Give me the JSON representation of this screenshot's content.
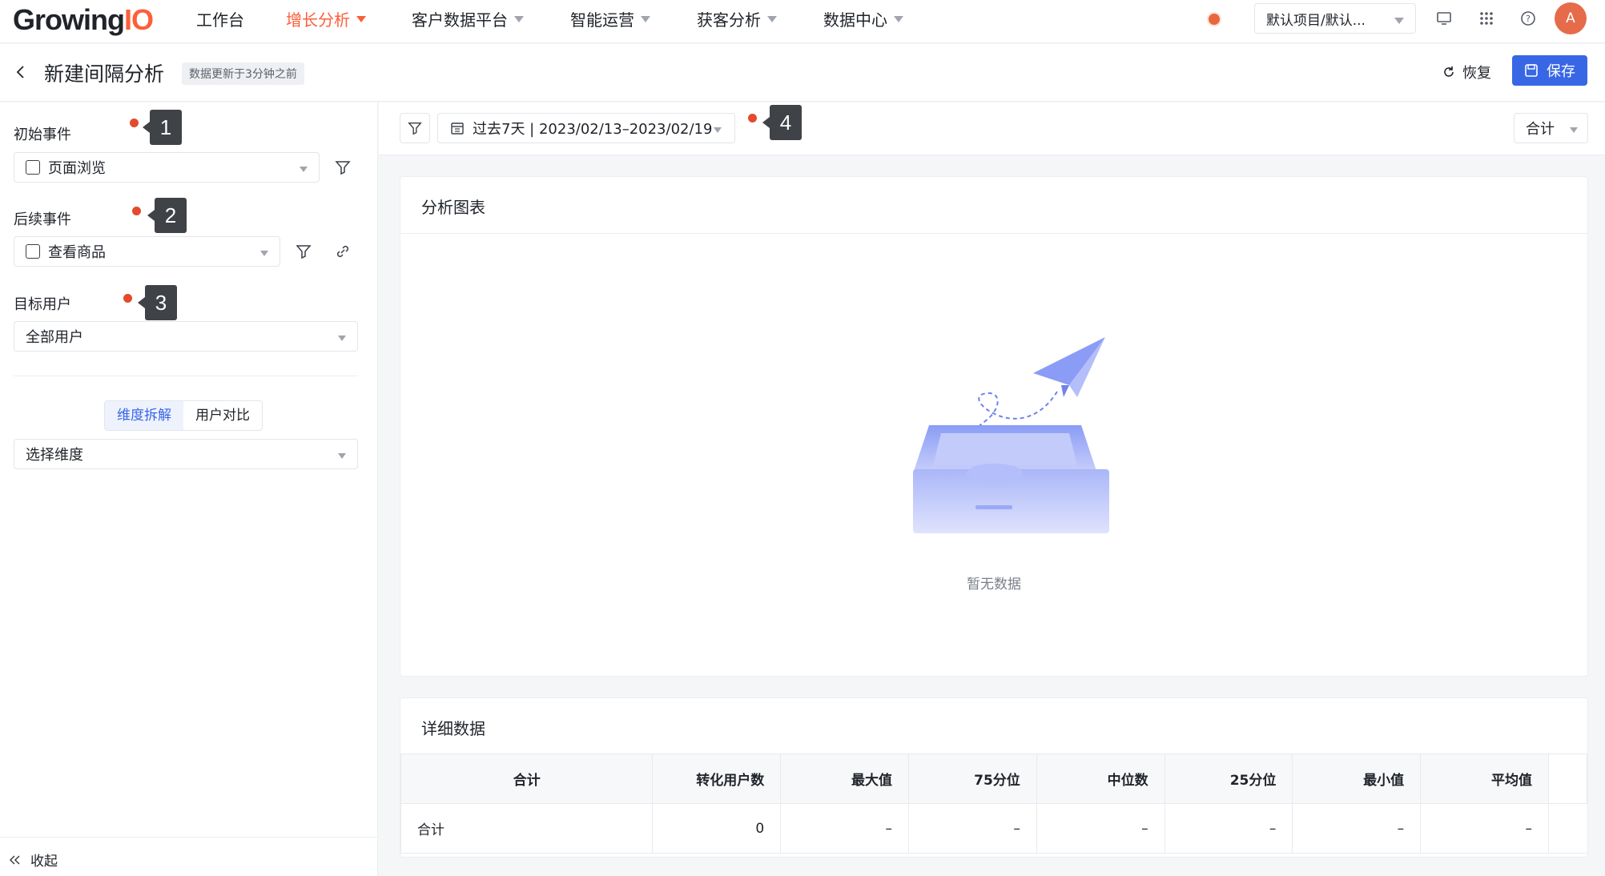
{
  "nav": {
    "logo_main": "Growing",
    "logo_io": "IO",
    "items": [
      {
        "label": "工作台"
      },
      {
        "label": "增长分析"
      },
      {
        "label": "客户数据平台"
      },
      {
        "label": "智能运营"
      },
      {
        "label": "获客分析"
      },
      {
        "label": "数据中心"
      }
    ],
    "project": "默认项目/默认...",
    "avatar": "A"
  },
  "header": {
    "title": "新建间隔分析",
    "update_badge": "数据更新于3分钟之前",
    "restore": "恢复",
    "save": "保存"
  },
  "sidebar": {
    "initial_event_label": "初始事件",
    "initial_event_value": "页面浏览",
    "follow_event_label": "后续事件",
    "follow_event_value": "查看商品",
    "target_user_label": "目标用户",
    "target_user_value": "全部用户",
    "seg_dimension": "维度拆解",
    "seg_compare": "用户对比",
    "dimension_placeholder": "选择维度",
    "collapse": "收起"
  },
  "annotations": [
    "1",
    "2",
    "3",
    "4"
  ],
  "toolbar": {
    "date_range": "过去7天 | 2023/02/13–2023/02/19",
    "aggregate": "合计"
  },
  "chart_card": {
    "title": "分析图表",
    "empty_text": "暂无数据"
  },
  "detail_card": {
    "title": "详细数据",
    "columns": [
      "合计",
      "转化用户数",
      "最大值",
      "75分位",
      "中位数",
      "25分位",
      "最小值",
      "平均值"
    ],
    "rows": [
      [
        "合计",
        "0",
        "–",
        "–",
        "–",
        "–",
        "–",
        "–"
      ]
    ]
  },
  "colors": {
    "brand_orange": "#fc5f3a",
    "primary_blue": "#3867e5",
    "annotation_red": "#e24b2d"
  }
}
